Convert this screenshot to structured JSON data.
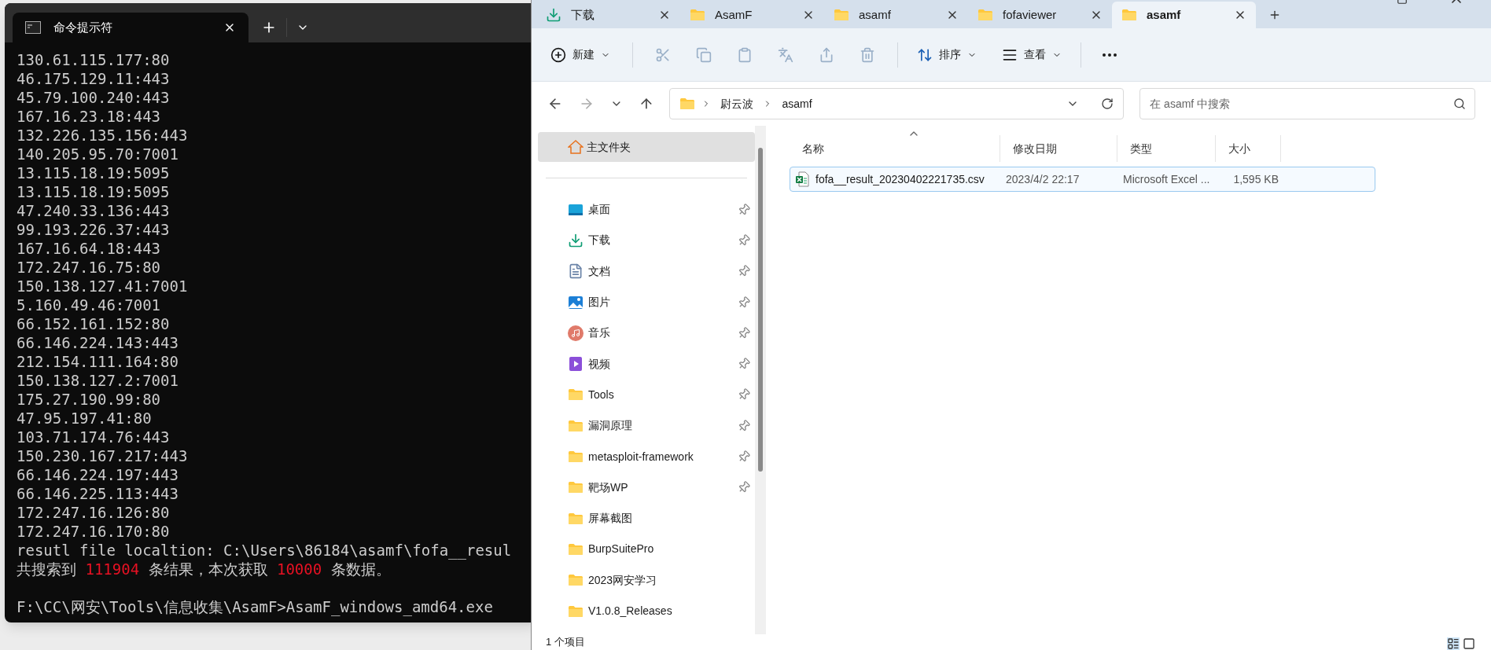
{
  "terminal": {
    "tab": {
      "title": "命令提示符",
      "selected": true
    },
    "lines": [
      {
        "kind": "plain",
        "text": "130.61.115.177:80"
      },
      {
        "kind": "plain",
        "text": "46.175.129.11:443"
      },
      {
        "kind": "plain",
        "text": "45.79.100.240:443"
      },
      {
        "kind": "plain",
        "text": "167.16.23.18:443"
      },
      {
        "kind": "plain",
        "text": "132.226.135.156:443"
      },
      {
        "kind": "plain",
        "text": "140.205.95.70:7001"
      },
      {
        "kind": "plain",
        "text": "13.115.18.19:5095"
      },
      {
        "kind": "plain",
        "text": "13.115.18.19:5095"
      },
      {
        "kind": "plain",
        "text": "47.240.33.136:443"
      },
      {
        "kind": "plain",
        "text": "99.193.226.37:443"
      },
      {
        "kind": "plain",
        "text": "167.16.64.18:443"
      },
      {
        "kind": "plain",
        "text": "172.247.16.75:80"
      },
      {
        "kind": "plain",
        "text": "150.138.127.41:7001"
      },
      {
        "kind": "plain",
        "text": "5.160.49.46:7001"
      },
      {
        "kind": "plain",
        "text": "66.152.161.152:80"
      },
      {
        "kind": "plain",
        "text": "66.146.224.143:443"
      },
      {
        "kind": "plain",
        "text": "212.154.111.164:80"
      },
      {
        "kind": "plain",
        "text": "150.138.127.2:7001"
      },
      {
        "kind": "plain",
        "text": "175.27.190.99:80"
      },
      {
        "kind": "plain",
        "text": "47.95.197.41:80"
      },
      {
        "kind": "plain",
        "text": "103.71.174.76:443"
      },
      {
        "kind": "plain",
        "text": "150.230.167.217:443"
      },
      {
        "kind": "plain",
        "text": "66.146.224.197:443"
      },
      {
        "kind": "plain",
        "text": "66.146.225.113:443"
      },
      {
        "kind": "plain",
        "text": "172.247.16.126:80"
      },
      {
        "kind": "plain",
        "text": "172.247.16.170:80"
      },
      {
        "kind": "plain",
        "text": "resutl file localtion: C:\\Users\\86184\\asamf\\fofa__resul"
      },
      {
        "kind": "summary",
        "segments": [
          {
            "text": "共搜索到 ",
            "highlight": false
          },
          {
            "text": "111904",
            "highlight": true
          },
          {
            "text": " 条结果，本次获取 ",
            "highlight": false
          },
          {
            "text": "10000",
            "highlight": true
          },
          {
            "text": " 条数据。",
            "highlight": false
          }
        ]
      },
      {
        "kind": "blank"
      },
      {
        "kind": "plain",
        "text": "F:\\CC\\网安\\Tools\\信息收集\\AsamF>AsamF_windows_amd64.exe"
      }
    ]
  },
  "explorer": {
    "tabs": [
      {
        "label": "下载",
        "kind": "download",
        "selected": false
      },
      {
        "label": "AsamF",
        "kind": "folder",
        "selected": false
      },
      {
        "label": "asamf",
        "kind": "folder",
        "selected": false
      },
      {
        "label": "fofaviewer",
        "kind": "folder",
        "selected": false
      },
      {
        "label": "asamf",
        "kind": "folder",
        "selected": true
      }
    ],
    "toolbar": {
      "new": "新建",
      "sort": "排序",
      "view": "查看"
    },
    "address": {
      "crumbs": [
        "尉云波",
        "asamf"
      ]
    },
    "search": {
      "placeholder": "在 asamf 中搜索"
    },
    "sidebar": {
      "home": {
        "label": "主文件夹",
        "selected": true
      },
      "items": [
        {
          "label": "桌面",
          "kind": "desktop",
          "pinned": true
        },
        {
          "label": "下载",
          "kind": "download",
          "pinned": true
        },
        {
          "label": "文档",
          "kind": "document",
          "pinned": true
        },
        {
          "label": "图片",
          "kind": "picture",
          "pinned": true
        },
        {
          "label": "音乐",
          "kind": "music",
          "pinned": true
        },
        {
          "label": "视频",
          "kind": "video",
          "pinned": true
        },
        {
          "label": "Tools",
          "kind": "folder",
          "pinned": true
        },
        {
          "label": "漏洞原理",
          "kind": "folder",
          "pinned": true
        },
        {
          "label": "metasploit-framework",
          "kind": "folder",
          "pinned": true
        },
        {
          "label": "靶场WP",
          "kind": "folder",
          "pinned": true
        },
        {
          "label": "屏幕截图",
          "kind": "folder",
          "pinned": false
        },
        {
          "label": "BurpSuitePro",
          "kind": "folder",
          "pinned": false
        },
        {
          "label": "2023网安学习",
          "kind": "folder",
          "pinned": false
        },
        {
          "label": "V1.0.8_Releases",
          "kind": "folder",
          "pinned": false
        }
      ]
    },
    "columns": [
      "名称",
      "修改日期",
      "类型",
      "大小"
    ],
    "rows": [
      {
        "name": "fofa__result_20230402221735.csv",
        "modified": "2023/4/2 22:17",
        "type": "Microsoft Excel ...",
        "size": "1,595 KB",
        "selected": true
      }
    ],
    "status": "1 个项目"
  }
}
